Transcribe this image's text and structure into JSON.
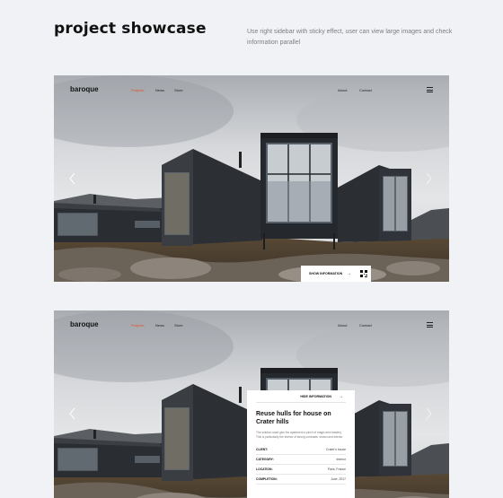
{
  "header": {
    "title": "project showcase",
    "description": "Use right sidebar with sticky effect, user can view large images and check information parallel"
  },
  "site": {
    "logo": "baroque",
    "nav_left": [
      "Projects",
      "News",
      "Store"
    ],
    "nav_right": [
      "About",
      "Contact"
    ],
    "active_nav": "Projects"
  },
  "info_bar": {
    "label": "SHOW INFORMATION",
    "arrow": "→"
  },
  "sidebar": {
    "header_label": "HIDE INFORMATION",
    "arrow": "→",
    "title": "Reuse hulls for house on Crater hills",
    "text": "The solution used give the apartment a pinch of magic and mastery. This is particularly the interior of strong contrasts: shown and interior.",
    "rows": [
      {
        "key": "CLIENT:",
        "value": "Crater's house"
      },
      {
        "key": "CATEGORY:",
        "value": "Interior"
      },
      {
        "key": "LOCATION:",
        "value": "Paris, France"
      },
      {
        "key": "COMPLETION:",
        "value": "June, 2017"
      }
    ]
  },
  "colors": {
    "accent": "#e34d2b",
    "background": "#f1f2f5",
    "cabin": "#2b2e33"
  },
  "icons": [
    "menu-icon",
    "arrow-left-icon",
    "arrow-right-icon",
    "qr-code-icon"
  ]
}
